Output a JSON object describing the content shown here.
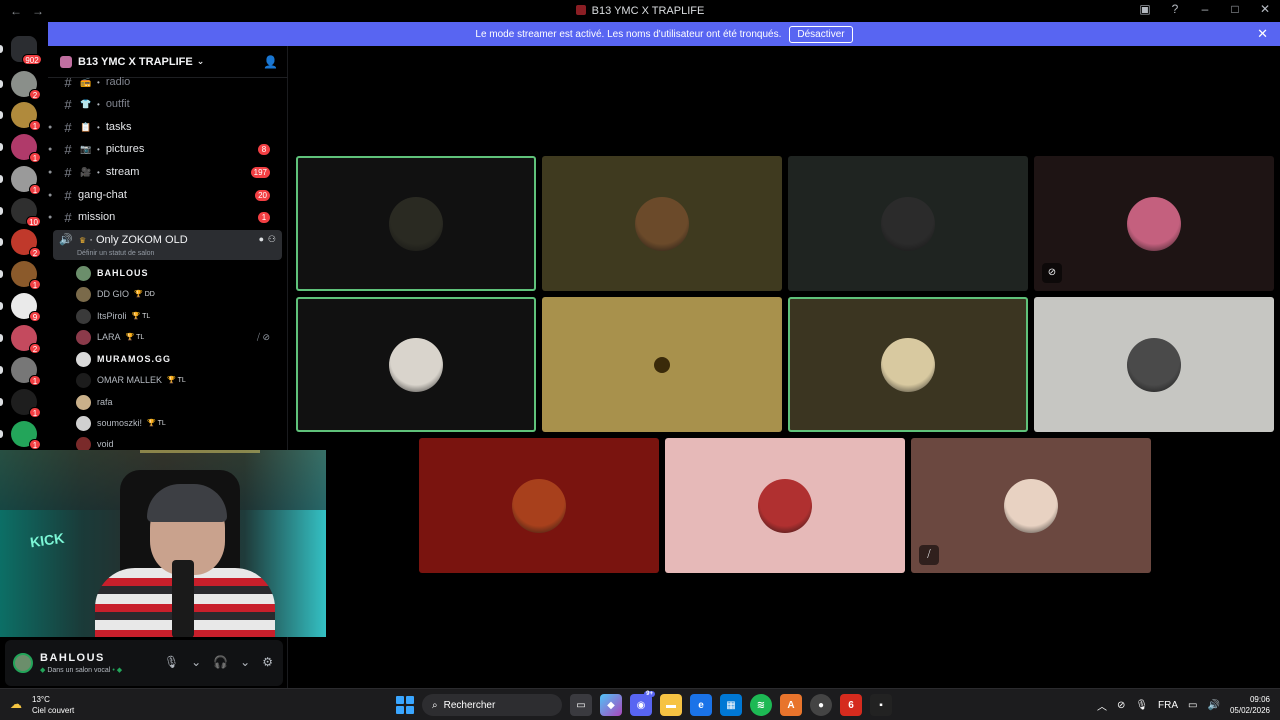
{
  "window": {
    "title": "B13 YMC X TRAPLIFE",
    "nav_back": "←",
    "nav_forward": "→"
  },
  "banner": {
    "message": "Le mode streamer est activé. Les noms d'utilisateur ont été tronqués.",
    "button": "Désactiver"
  },
  "servers": [
    {
      "badge": "902",
      "color": "#3a3a3a"
    },
    {
      "badge": "2",
      "color": "#8a8f8a"
    },
    {
      "badge": "1",
      "color": "#b08a3c"
    },
    {
      "badge": "1",
      "color": "#b03a6a"
    },
    {
      "badge": "1",
      "color": "#9a9a9a"
    },
    {
      "badge": "10",
      "color": "#2f2f2f"
    },
    {
      "badge": "2",
      "color": "#c0392b"
    },
    {
      "badge": "1",
      "color": "#8b5a2b"
    },
    {
      "badge": "9",
      "color": "#eaeaea"
    },
    {
      "badge": "2",
      "color": "#c44a5e"
    },
    {
      "badge": "1",
      "color": "#777777"
    },
    {
      "badge": "1",
      "color": "#1e1e1e"
    },
    {
      "badge": "1",
      "color": "#23a55a"
    }
  ],
  "sidebar": {
    "server_name": "B13 YMC X TRAPLIFE",
    "channels": [
      {
        "emoji": "📻",
        "name": "radio",
        "dim": true,
        "count": ""
      },
      {
        "emoji": "👕",
        "name": "outfit",
        "dim": true,
        "count": ""
      },
      {
        "emoji": "📋",
        "name": "tasks",
        "dim": false,
        "count": ""
      },
      {
        "emoji": "📷",
        "name": "pictures",
        "dim": false,
        "count": "8"
      },
      {
        "emoji": "🎥",
        "name": "stream",
        "dim": false,
        "count": "197"
      },
      {
        "emoji": "",
        "name": "gang-chat",
        "dim": false,
        "count": "20"
      },
      {
        "emoji": "",
        "name": "mission",
        "dim": false,
        "count": "1"
      }
    ],
    "voice_channel": {
      "name": "Only ZOKOM OLD",
      "status": "Définir un statut de salon"
    },
    "voice_users": [
      {
        "name": "BAHLOUS",
        "tag": "",
        "bold": true,
        "color": "#6b8e6b"
      },
      {
        "name": "DD GIO",
        "tag": "DD",
        "bold": false,
        "color": "#7a6a4a"
      },
      {
        "name": "ItsPiroli",
        "tag": "TL",
        "bold": false,
        "color": "#3a3a3a"
      },
      {
        "name": "LARA",
        "tag": "TL",
        "bold": false,
        "color": "#8b3a4a"
      },
      {
        "name": "MURAMOS.GG",
        "tag": "",
        "bold": true,
        "color": "#d9d9d9"
      },
      {
        "name": "OMAR MALLEK",
        "tag": "TL",
        "bold": false,
        "color": "#1c1c1c"
      },
      {
        "name": "rafa",
        "tag": "",
        "bold": false,
        "color": "#c9b08a"
      },
      {
        "name": "soumoszki!",
        "tag": "TL",
        "bold": false,
        "color": "#d0d0d0"
      },
      {
        "name": "void",
        "tag": "",
        "bold": false,
        "color": "#7a2a2a"
      }
    ]
  },
  "user_panel": {
    "name": "BAHLOUS",
    "status": "Dans un salon vocal"
  },
  "video_tiles": [
    {
      "bg": "#111111",
      "avatar": "#2a2a22",
      "speaking": true,
      "overlay": ""
    },
    {
      "bg": "#3f3a1f",
      "avatar": "#6b4a2a",
      "speaking": false,
      "overlay": ""
    },
    {
      "bg": "#1f2421",
      "avatar": "#2b2b2b",
      "speaking": false,
      "overlay": ""
    },
    {
      "bg": "#1e1414",
      "avatar": "#c4607e",
      "speaking": false,
      "overlay": "⊘"
    },
    {
      "bg": "#111111",
      "avatar": "#d9d4cc",
      "speaking": true,
      "overlay": ""
    },
    {
      "bg": "#a8914c",
      "avatar": "#a8914c",
      "speaking": false,
      "overlay": ""
    },
    {
      "bg": "#3b3521",
      "avatar": "#d8c9a0",
      "speaking": true,
      "overlay": ""
    },
    {
      "bg": "#c6c6c2",
      "avatar": "#4a4a4a",
      "speaking": false,
      "overlay": ""
    },
    {
      "bg": "#7a140f",
      "avatar": "#a8401c",
      "speaking": false,
      "overlay": ""
    },
    {
      "bg": "#e6b9b8",
      "avatar": "#b03030",
      "speaking": false,
      "overlay": ""
    },
    {
      "bg": "#6b4840",
      "avatar": "#e8d2c2",
      "speaking": false,
      "overlay": "⧸"
    }
  ],
  "taskbar": {
    "temp": "13°C",
    "weather": "Ciel couvert",
    "search": "Rechercher",
    "lang": "FRA",
    "time": "09:06",
    "date": "05/02/2026",
    "discord_badge": "9+"
  }
}
